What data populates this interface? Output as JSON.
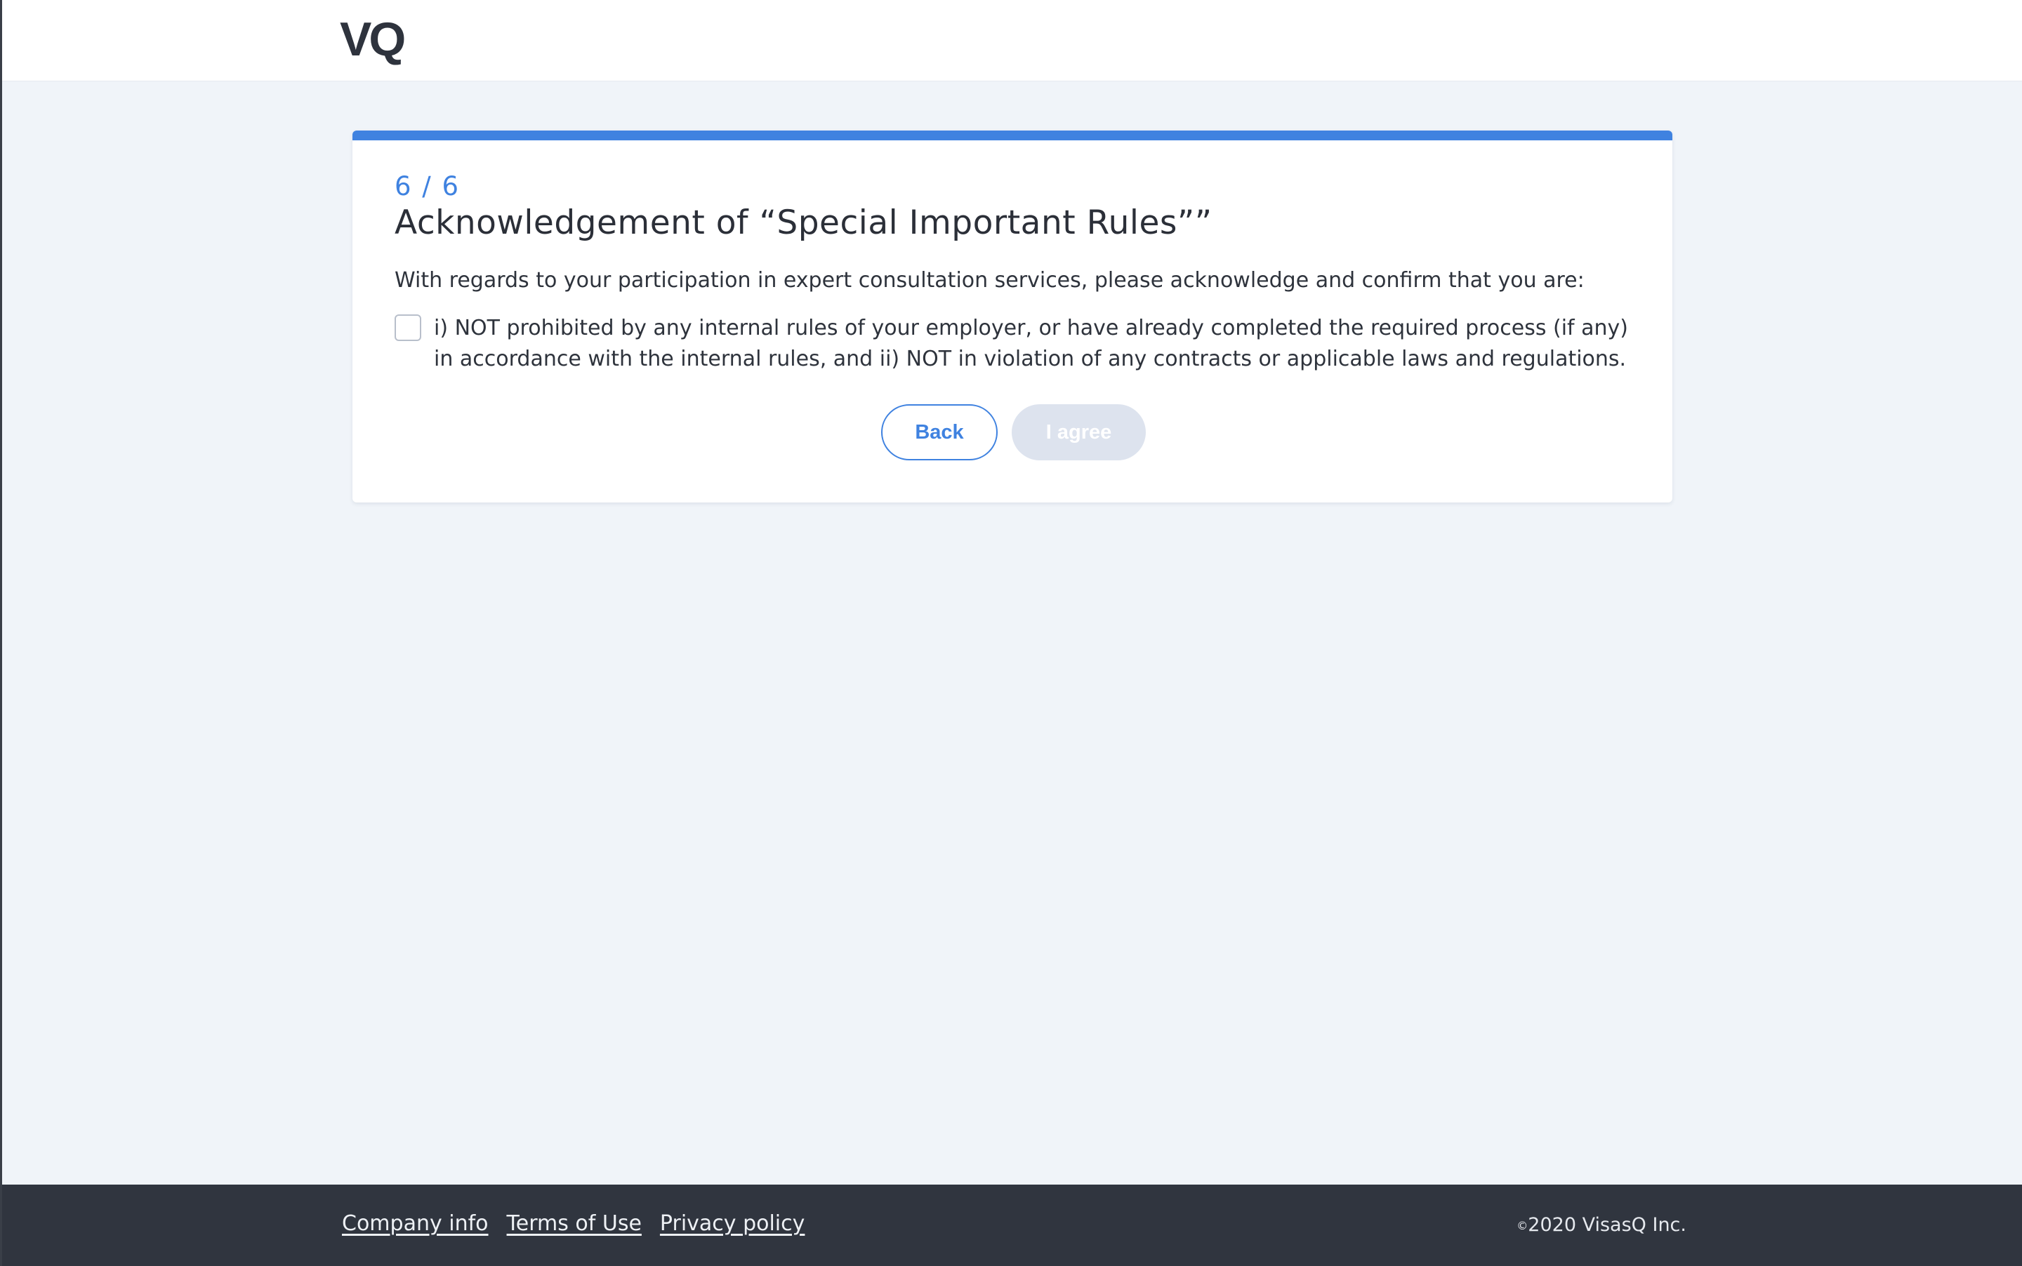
{
  "header": {
    "logo_text": "VQ"
  },
  "card": {
    "step": "6 / 6",
    "title": "Acknowledgement of “Special Important Rules””",
    "intro": "With regards to your participation in expert consultation services, please acknowledge and confirm that you are:",
    "acknowledgement": {
      "checked": false,
      "text": "i) NOT prohibited by any internal rules of your employer, or have already completed the required process (if any) in accordance with the internal rules, and ii) NOT in violation of any contracts or applicable laws and regulations."
    },
    "buttons": {
      "back_label": "Back",
      "agree_label": "I agree",
      "agree_disabled": true
    }
  },
  "footer": {
    "links": [
      {
        "label": "Company info"
      },
      {
        "label": "Terms of Use"
      },
      {
        "label": "Privacy policy"
      }
    ],
    "copyright_symbol": "©",
    "copyright_text": "2020 VisasQ Inc."
  },
  "colors": {
    "accent": "#3f82e0",
    "page_background": "#f0f4f9",
    "footer_background": "#30353f",
    "disabled_button": "#dde3ee"
  }
}
